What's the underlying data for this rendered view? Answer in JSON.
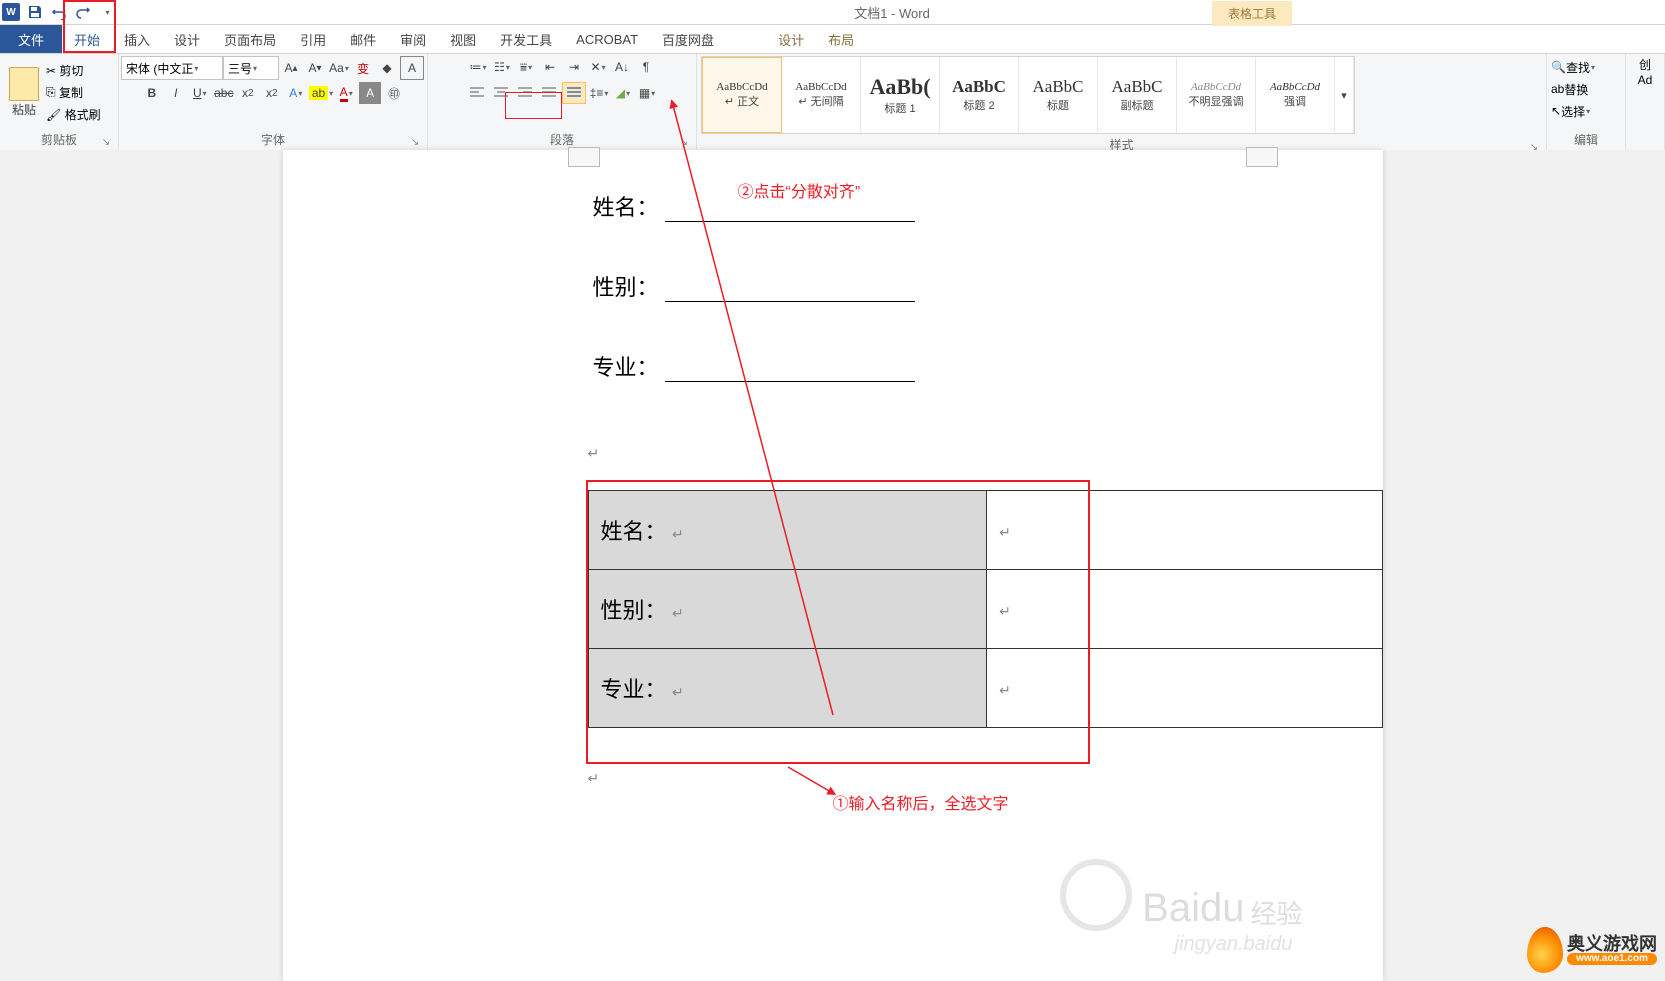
{
  "app": {
    "title": "文档1 - Word",
    "context_tool_label": "表格工具"
  },
  "qat": {
    "word_icon_letter": "W",
    "save": "保存",
    "undo": "撤销",
    "redo": "恢复"
  },
  "tabs": {
    "file": "文件",
    "home": "开始",
    "insert": "插入",
    "design": "设计",
    "page_layout": "页面布局",
    "references": "引用",
    "mail": "邮件",
    "review": "审阅",
    "view": "视图",
    "dev": "开发工具",
    "acrobat": "ACROBAT",
    "baidu": "百度网盘",
    "ctx_design": "设计",
    "ctx_layout": "布局"
  },
  "clipboard": {
    "paste": "粘贴",
    "cut": "剪切",
    "copy": "复制",
    "format_painter": "格式刷",
    "group_label": "剪贴板"
  },
  "font": {
    "name_value": "宋体 (中文正",
    "size_value": "三号",
    "group_label": "字体"
  },
  "paragraph": {
    "group_label": "段落"
  },
  "styles": {
    "preview_sample1": "AaBbCcDd",
    "preview_sample2": "AaBbCcDd",
    "preview_big": "AaBb(",
    "preview_med": "AaBbC",
    "preview_italic": "AaBbCcDd",
    "items": {
      "normal": "↵ 正文",
      "no_spacing": "↵ 无间隔",
      "heading1": "标题 1",
      "heading2": "标题 2",
      "title": "标题",
      "subtitle": "副标题",
      "subtle_em": "不明显强调",
      "emphasis": "强调"
    },
    "group_label": "样式"
  },
  "editing": {
    "find": "查找",
    "replace": "替换",
    "select": "选择",
    "group_label": "编辑",
    "other1": "创",
    "other2": "Ad"
  },
  "document": {
    "fields": {
      "name": "姓名：",
      "gender": "性别：",
      "major": "专业："
    },
    "paragraph_mark": "↵"
  },
  "annotations": {
    "step1": "①输入名称后，全选文字",
    "step2": "②点击“分散对齐”"
  },
  "watermark": {
    "main": "Baidu",
    "sub1": "经验",
    "url": "jingyan.baidu"
  },
  "site_badge": {
    "name": "奥义游戏网",
    "url": "www.aoe1.com"
  }
}
